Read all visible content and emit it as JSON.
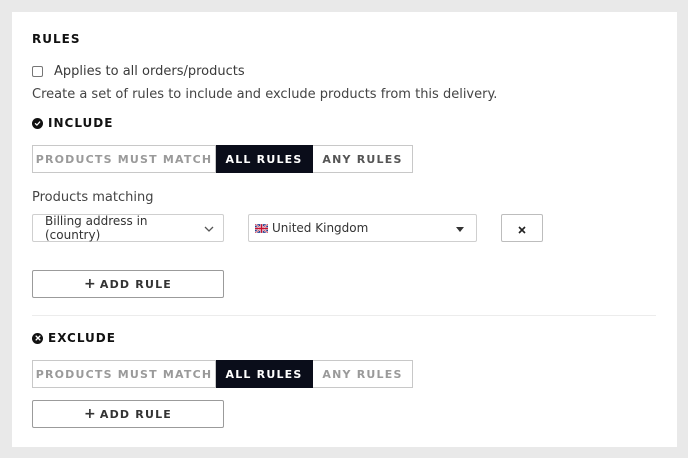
{
  "rules": {
    "title": "RULES",
    "applies_all_label": "Applies to all orders/products",
    "applies_all_checked": false,
    "description": "Create a set of rules to include and exclude products from this delivery."
  },
  "include": {
    "heading": "INCLUDE",
    "match_options": [
      "PRODUCTS MUST MATCH",
      "ALL RULES",
      "ANY RULES"
    ],
    "selected": "ALL RULES",
    "products_matching_label": "Products matching",
    "rule": {
      "field_value": "Billing address in (country)",
      "country_value": "United Kingdom"
    },
    "add_rule_label": "ADD RULE"
  },
  "exclude": {
    "heading": "EXCLUDE",
    "match_options": [
      "PRODUCTS MUST MATCH",
      "ALL RULES",
      "ANY RULES"
    ],
    "selected": "ALL RULES",
    "add_rule_label": "ADD RULE"
  },
  "icons": {
    "include": "check-circle-icon",
    "exclude": "x-circle-icon",
    "close": "close-icon",
    "plus": "plus-icon"
  },
  "colors": {
    "active_segment": "#0a0d1a",
    "background": "#e9e9e9"
  }
}
